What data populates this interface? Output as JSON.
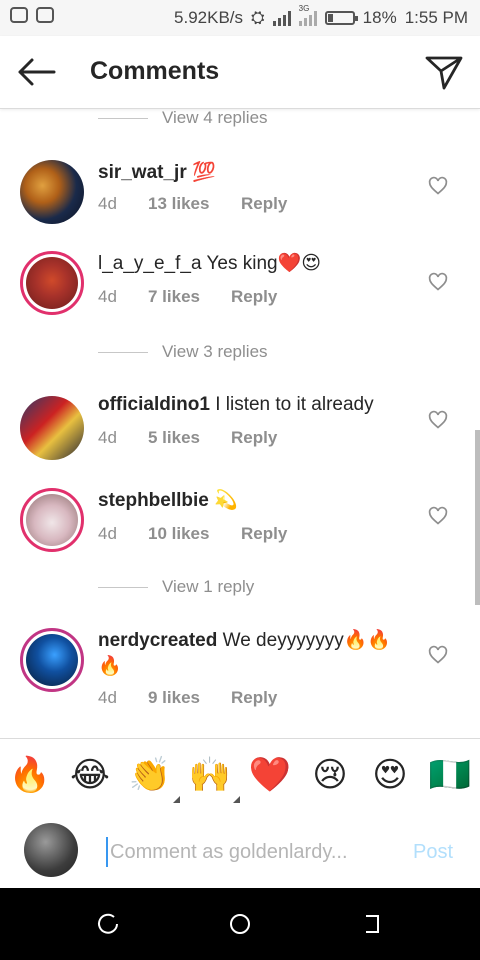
{
  "status_bar": {
    "speed": "5.92KB/s",
    "network": "3G",
    "battery": "18%",
    "time": "1:55 PM"
  },
  "header": {
    "title": "Comments"
  },
  "comments": [
    {
      "type": "view_replies",
      "label": "View 4 replies"
    },
    {
      "type": "comment",
      "username": "sir_wat_jr",
      "text": "💯",
      "time": "4d",
      "likes": "13 likes",
      "reply": "Reply"
    },
    {
      "type": "comment",
      "username": "l_a_y_e_f_a",
      "text": "Yes king❤️😍",
      "time": "4d",
      "likes": "7 likes",
      "reply": "Reply"
    },
    {
      "type": "view_replies",
      "label": "View 3 replies"
    },
    {
      "type": "comment",
      "username": "officialdino1",
      "text": "I listen to it already",
      "time": "4d",
      "likes": "5 likes",
      "reply": "Reply"
    },
    {
      "type": "comment",
      "username": "stephbellbie",
      "text": "💫",
      "time": "4d",
      "likes": "10 likes",
      "reply": "Reply"
    },
    {
      "type": "view_replies",
      "label": "View 1 reply"
    },
    {
      "type": "comment",
      "username": "nerdycreated",
      "text": "We deyyyyyyy🔥🔥🔥",
      "time": "4d",
      "likes": "9 likes",
      "reply": "Reply"
    }
  ],
  "emoji_bar": [
    "🔥",
    "😂",
    "👏",
    "🙌",
    "❤️",
    "😢",
    "😍",
    "🇳🇬"
  ],
  "composer": {
    "placeholder": "Comment as goldenlardy...",
    "post_label": "Post"
  },
  "colors": {
    "accent": "#3897f0",
    "post_disabled": "#b2dffc",
    "story_ring": "#e1306c",
    "heart_red": "#ed4956"
  }
}
